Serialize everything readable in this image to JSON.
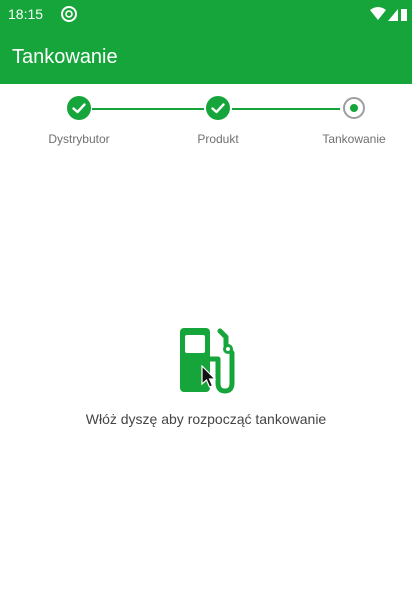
{
  "status": {
    "time": "18:15",
    "icons": [
      "app-notification-icon",
      "wifi-icon",
      "signal-icon",
      "battery-icon"
    ]
  },
  "appbar": {
    "title": "Tankowanie",
    "color": "#15a53a"
  },
  "stepper": {
    "steps": [
      {
        "label": "Dystrybutor",
        "state": "done"
      },
      {
        "label": "Produkt",
        "state": "done"
      },
      {
        "label": "Tankowanie",
        "state": "current"
      }
    ],
    "active_color": "#15a53a",
    "pending_color": "#9e9e9e"
  },
  "main": {
    "icon": "fuel-pump-icon",
    "message": "Włóż dyszę aby rozpocząć tankowanie"
  }
}
